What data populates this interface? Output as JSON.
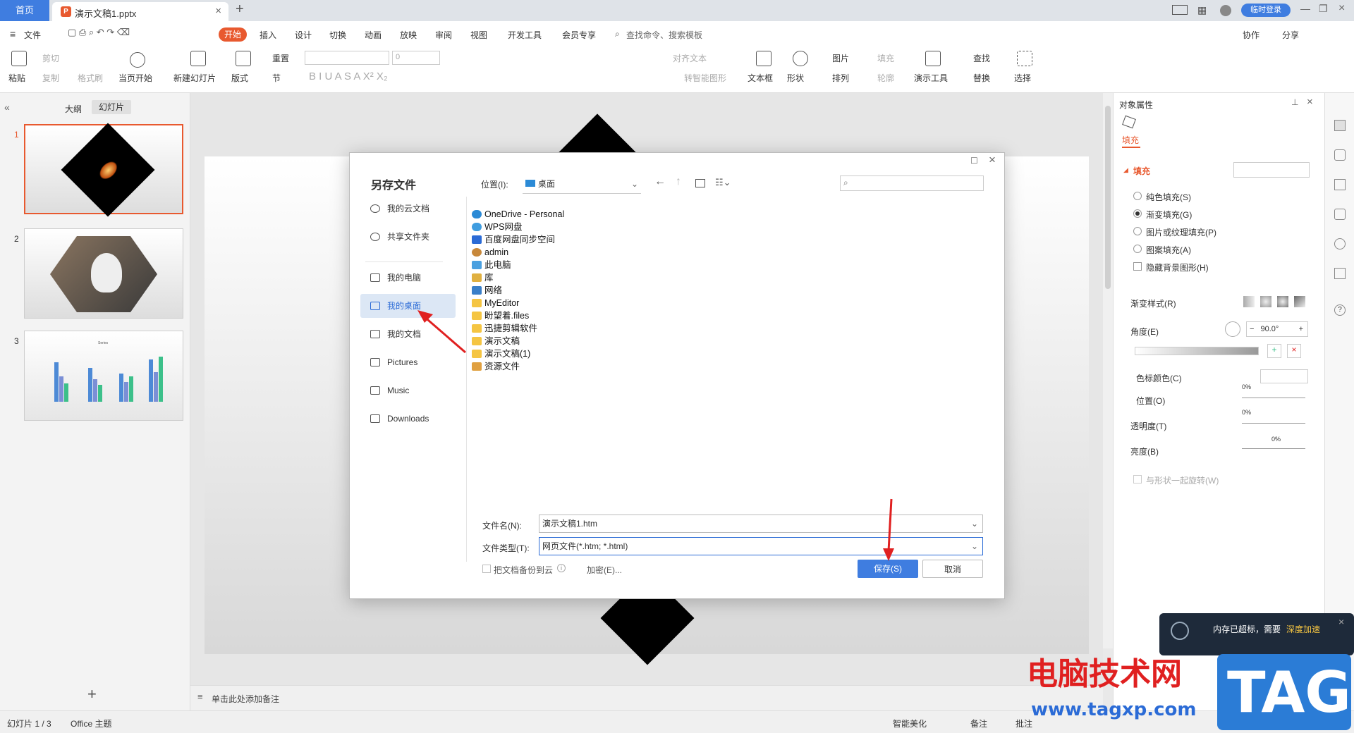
{
  "tabbar": {
    "home": "首页",
    "doc_tab": "演示文稿1.pptx",
    "login": "临时登录"
  },
  "menu": {
    "file": "文件",
    "items": [
      "开始",
      "插入",
      "设计",
      "切换",
      "动画",
      "放映",
      "审阅",
      "视图",
      "开发工具",
      "会员专享"
    ],
    "search": "查找命令、搜索模板",
    "right": [
      "协作",
      "分享"
    ]
  },
  "ribbon": {
    "paste": "粘贴",
    "cut": "剪切",
    "copy": "复制",
    "format_painter": "格式刷",
    "from_current": "当页开始",
    "new_slide": "新建幻灯片",
    "layout": "版式",
    "section": "节",
    "reset": "重置",
    "font_size": "0",
    "align_text": "对齐文本",
    "smart_convert": "转智能图形",
    "textbox": "文本框",
    "shape": "形状",
    "picture": "图片",
    "arrange": "排列",
    "fill": "填充",
    "outline": "轮廓",
    "present_tools": "演示工具",
    "find": "查找",
    "replace": "替换",
    "select": "选择"
  },
  "leftpane": {
    "outline_tab": "大纲",
    "slides_tab": "幻灯片",
    "slide_numbers": [
      "1",
      "2",
      "3"
    ],
    "chart_title": "Series"
  },
  "notes": {
    "placeholder": "单击此处添加备注"
  },
  "status": {
    "slide_count": "幻灯片 1 / 3",
    "theme": "Office 主题",
    "beautify": "智能美化",
    "notes": "备注",
    "comments": "批注"
  },
  "rightpane": {
    "title": "对象属性",
    "tab_fill": "填充",
    "section_fill": "填充",
    "options": [
      "纯色填充(S)",
      "渐变填充(G)",
      "图片或纹理填充(P)",
      "图案填充(A)"
    ],
    "selected_option": 1,
    "hide_bg": "隐藏背景图形(H)",
    "gradient_style": "渐变样式(R)",
    "angle_label": "角度(E)",
    "angle_value": "90.0°",
    "stop_color": "色标颜色(C)",
    "position_label": "位置(O)",
    "position_value": "0%",
    "transparency_label": "透明度(T)",
    "transparency_value": "0%",
    "brightness_label": "亮度(B)",
    "brightness_value": "0%",
    "rotate_with_shape": "与形状一起旋转(W)"
  },
  "dialog": {
    "title": "另存文件",
    "location_label": "位置(I):",
    "location_value": "桌面",
    "sidebar": [
      "我的云文档",
      "共享文件夹",
      "我的电脑",
      "我的桌面",
      "我的文档",
      "Pictures",
      "Music",
      "Downloads"
    ],
    "selected_sidebar": 3,
    "files": [
      {
        "name": "OneDrive - Personal",
        "type": "cloud"
      },
      {
        "name": "WPS网盘",
        "type": "cloud"
      },
      {
        "name": "百度网盘同步空间",
        "type": "app"
      },
      {
        "name": "admin",
        "type": "user"
      },
      {
        "name": "此电脑",
        "type": "pc"
      },
      {
        "name": "库",
        "type": "lib"
      },
      {
        "name": "网络",
        "type": "net"
      },
      {
        "name": "MyEditor",
        "type": "folder"
      },
      {
        "name": "盼望着.files",
        "type": "folder"
      },
      {
        "name": "迅捷剪辑软件",
        "type": "folder"
      },
      {
        "name": "演示文稿",
        "type": "folder"
      },
      {
        "name": "演示文稿(1)",
        "type": "folder"
      },
      {
        "name": "资源文件",
        "type": "folder"
      }
    ],
    "filename_label": "文件名(N):",
    "filename_value": "演示文稿1.htm",
    "filetype_label": "文件类型(T):",
    "filetype_value": "网页文件(*.htm; *.html)",
    "backup_label": "把文档备份到云",
    "encrypt_label": "加密(E)...",
    "save_label": "保存(S)",
    "cancel_label": "取消"
  },
  "popup": {
    "text": "内存已超标，需要",
    "link": "深度加速"
  },
  "watermark": {
    "cn": "电脑技术网",
    "url": "www.tagxp.com",
    "tag": "TAG"
  },
  "colors": {
    "accent": "#3f7de0",
    "orange": "#e8592f",
    "red_arrow": "#e02020"
  }
}
